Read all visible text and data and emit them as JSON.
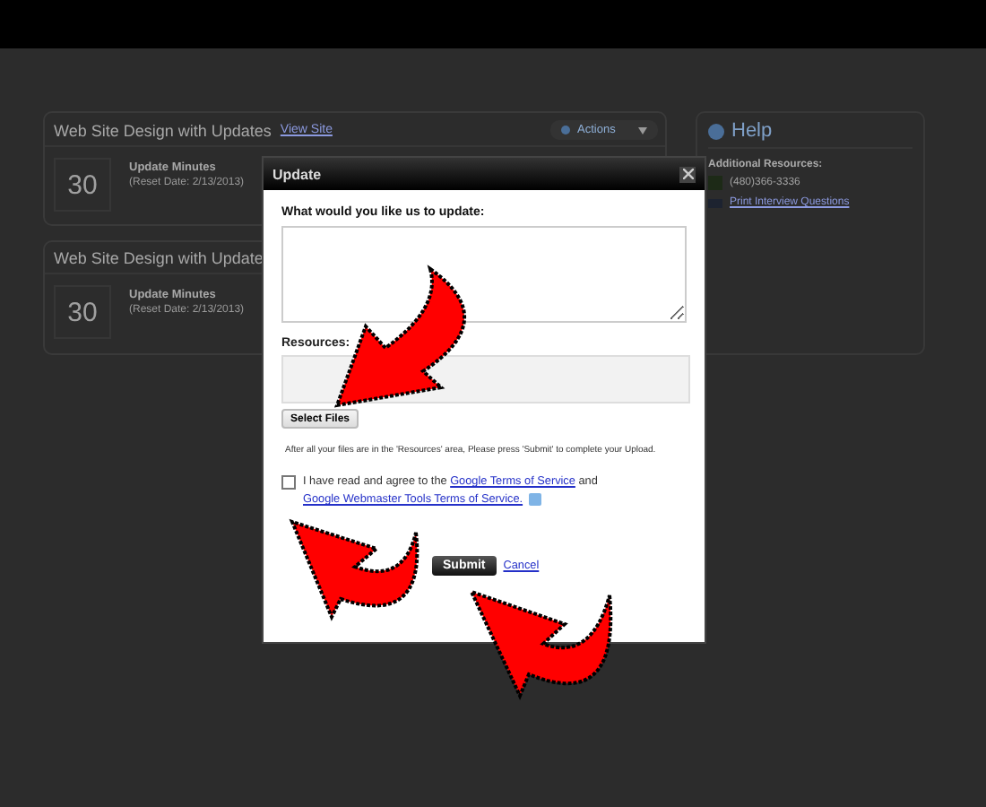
{
  "cards": [
    {
      "title": "Web Site Design with Updates",
      "link": "View Site",
      "actions": "Actions",
      "minutes": "30",
      "label": "Update Minutes",
      "reset": "(Reset Date: 2/13/2013)"
    },
    {
      "title": "Web Site Design with Update",
      "minutes": "30",
      "label": "Update Minutes",
      "reset": "(Reset Date: 2/13/2013)"
    }
  ],
  "help": {
    "title": "Help",
    "heading": "Additional Resources:",
    "phone": "(480)366-3336",
    "link": "Print Interview Questions"
  },
  "dialog": {
    "title": "Update",
    "prompt": "What would you like us to update:",
    "resources_label": "Resources:",
    "select_button": "Select Files",
    "note": "After all your files are in the 'Resources' area, Please press 'Submit' to complete your Upload.",
    "agree": {
      "checked": false,
      "text": "I have read and agree to the",
      "link1": "Google Terms of Service",
      "and": "and",
      "link2": "Google Webmaster Tools Terms of Service."
    },
    "submit": "Submit",
    "cancel": "Cancel"
  }
}
